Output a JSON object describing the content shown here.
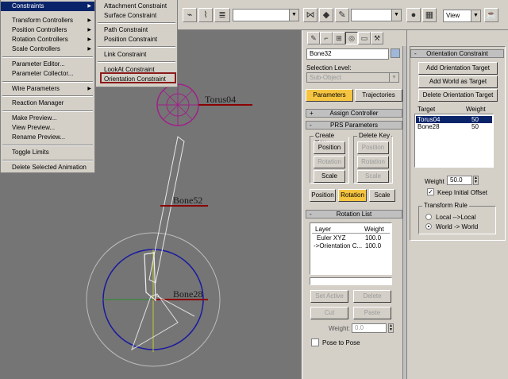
{
  "toolbar": {
    "view_select": "View",
    "icons": [
      "link-icon",
      "unlink-icon",
      "bind-spacewarp-icon",
      "select-icon",
      "select-by-name-icon",
      "text-icon",
      "mirror-icon",
      "align-icon",
      "curve-editor-icon",
      "schematic-icon",
      "material-editor-icon",
      "render-scene-icon",
      "quick-render-icon"
    ]
  },
  "main_menu": {
    "items": [
      {
        "label": "Constraints",
        "submenu": true,
        "highlighted": true
      },
      {
        "label": "Transform Controllers",
        "submenu": true
      },
      {
        "label": "Position Controllers",
        "submenu": true
      },
      {
        "label": "Rotation Controllers",
        "submenu": true
      },
      {
        "label": "Scale Controllers",
        "submenu": true
      },
      {
        "label": "Parameter Editor..."
      },
      {
        "label": "Parameter Collector..."
      },
      {
        "label": "Wire Parameters",
        "submenu": true
      },
      {
        "label": "Reaction Manager"
      },
      {
        "label": "Make Preview..."
      },
      {
        "label": "View Preview..."
      },
      {
        "label": "Rename Preview..."
      },
      {
        "label": "Toggle Limits"
      },
      {
        "label": "Delete Selected Animation"
      }
    ]
  },
  "constraints_submenu": {
    "items": [
      "Attachment Constraint",
      "Surface Constraint",
      "Path Constraint",
      "Position Constraint",
      "Link Constraint",
      "LookAt Constraint",
      "Orientation Constraint"
    ]
  },
  "viewport": {
    "labels": [
      "Torus04",
      "Bone52",
      "Bone28"
    ]
  },
  "command_panel": {
    "object_name": "Bone32",
    "selection_level_label": "Selection Level:",
    "selection_level_value": "Sub-Object",
    "tabs": [
      "Parameters",
      "Trajectories"
    ],
    "assign_controller_header": "Assign Controller",
    "prs_header": "PRS Parameters",
    "create_key_title": "Create Key",
    "delete_key_title": "Delete Key",
    "key_buttons": [
      "Position",
      "Rotation",
      "Scale"
    ],
    "prs_modes": [
      "Position",
      "Rotation",
      "Scale"
    ],
    "rotation_list_header": "Rotation List",
    "list_headers": [
      "Layer",
      "Weight"
    ],
    "list_rows": [
      {
        "layer": "Euler XYZ",
        "weight": "100.0"
      },
      {
        "layer": "->Orientation C...",
        "weight": "100.0"
      }
    ],
    "set_active": "Set Active",
    "delete": "Delete",
    "cut": "Cut",
    "paste": "Paste",
    "weight_label": "Weight:",
    "weight_value": "0.0",
    "pose_to_pose": "Pose to Pose"
  },
  "orientation_panel": {
    "header": "Orientation Constraint",
    "add_target": "Add Orientation Target",
    "add_world": "Add World as Target",
    "delete_target": "Delete Orientation Target",
    "col_target": "Target",
    "col_weight": "Weight",
    "targets": [
      {
        "name": "Torus04",
        "weight": "50"
      },
      {
        "name": "Bone28",
        "weight": "50"
      }
    ],
    "weight_label": "Weight",
    "weight_value": "50.0",
    "keep_initial_offset": "Keep Initial Offset",
    "transform_rule_title": "Transform Rule",
    "rule_local": "Local -->Local",
    "rule_world": "World -> World"
  },
  "colors": {
    "menu_highlight": "#0a246a",
    "yellow_tab": "#f5c542",
    "viewport_bg": "#757575",
    "torus": "#a0208a",
    "circle_blue": "#1a1aa0",
    "label_underline": "#8b0000"
  }
}
